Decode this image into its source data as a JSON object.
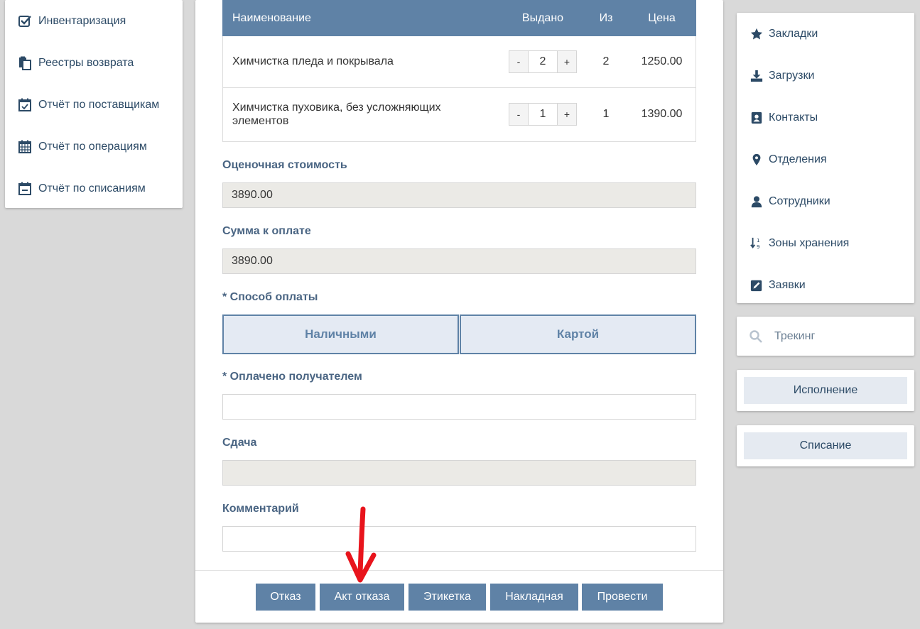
{
  "left_menu": {
    "items": [
      {
        "label": "Инвентаризация",
        "icon": "checkbox-icon"
      },
      {
        "label": "Реестры возврата",
        "icon": "documents-icon"
      },
      {
        "label": "Отчёт по поставщикам",
        "icon": "calendar-check-icon"
      },
      {
        "label": "Отчёт по операциям",
        "icon": "calendar-grid-icon"
      },
      {
        "label": "Отчёт по списаниям",
        "icon": "calendar-minus-icon"
      }
    ]
  },
  "items_table": {
    "headers": {
      "name": "Наименование",
      "issued": "Выдано",
      "of": "Из",
      "price": "Цена"
    },
    "rows": [
      {
        "name": "Химчистка пледа и покрывала",
        "issued": "2",
        "of": "2",
        "price": "1250.00",
        "minus": "-",
        "plus": "+"
      },
      {
        "name": "Химчистка пуховика, без усложняющих элементов",
        "issued": "1",
        "of": "1",
        "price": "1390.00",
        "minus": "-",
        "plus": "+"
      }
    ]
  },
  "form": {
    "estimated_cost_label": "Оценочная стоимость",
    "estimated_cost_value": "3890.00",
    "amount_due_label": "Сумма к оплате",
    "amount_due_value": "3890.00",
    "payment_method_label": "* Способ оплаты",
    "payment_cash": "Наличными",
    "payment_card": "Картой",
    "paid_by_recipient_label": "* Оплачено получателем",
    "paid_by_recipient_value": "",
    "change_label": "Сдача",
    "change_value": "",
    "comment_label": "Комментарий",
    "comment_value": ""
  },
  "actions": {
    "refusal": "Отказ",
    "refusal_act": "Акт отказа",
    "label": "Этикетка",
    "waybill": "Накладная",
    "post": "Провести"
  },
  "right_menu": {
    "items": [
      {
        "label": "Закладки",
        "icon": "star-icon"
      },
      {
        "label": "Загрузки",
        "icon": "download-icon"
      },
      {
        "label": "Контакты",
        "icon": "contact-book-icon"
      },
      {
        "label": "Отделения",
        "icon": "map-marker-icon"
      },
      {
        "label": "Сотрудники",
        "icon": "user-icon"
      },
      {
        "label": "Зоны хранения",
        "icon": "sort-numeric-icon"
      },
      {
        "label": "Заявки",
        "icon": "edit-icon"
      }
    ]
  },
  "tracking": {
    "placeholder": "Трекинг"
  },
  "side_buttons": {
    "execution": "Исполнение",
    "write_off": "Списание"
  },
  "colors": {
    "primary": "#5f82a6",
    "text": "#2c4a66",
    "readonly_bg": "#ebeae6",
    "annotation_arrow": "#e8141c"
  }
}
